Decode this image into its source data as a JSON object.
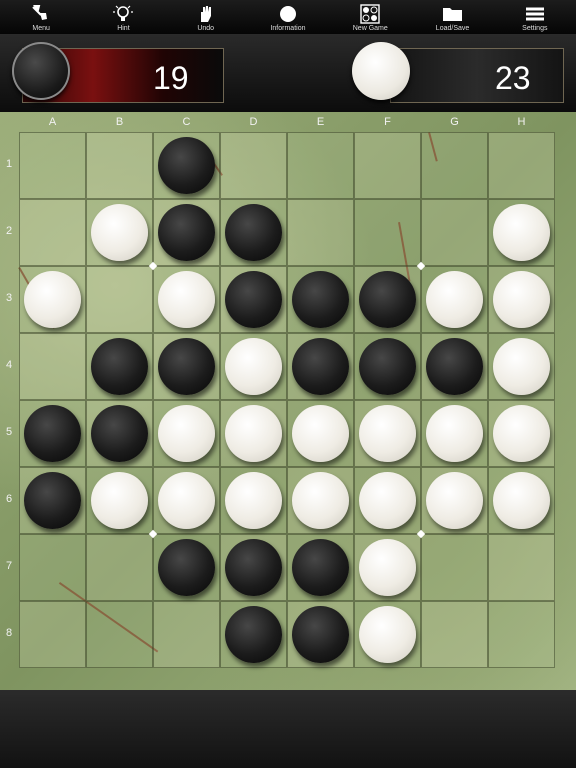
{
  "toolbar": {
    "items": [
      {
        "label": "Menu",
        "icon": "menu-hand-icon"
      },
      {
        "label": "Hint",
        "icon": "lightbulb-icon"
      },
      {
        "label": "Undo",
        "icon": "hand-icon"
      },
      {
        "label": "Information",
        "icon": "info-dot-icon"
      },
      {
        "label": "New Game",
        "icon": "new-game-grid-icon"
      },
      {
        "label": "Load/Save",
        "icon": "folder-icon"
      },
      {
        "label": "Settings",
        "icon": "wrench-icon"
      }
    ]
  },
  "scores": {
    "black": "19",
    "white": "23"
  },
  "board": {
    "columns": [
      "A",
      "B",
      "C",
      "D",
      "E",
      "F",
      "G",
      "H"
    ],
    "rows": [
      "1",
      "2",
      "3",
      "4",
      "5",
      "6",
      "7",
      "8"
    ],
    "cells": [
      [
        "",
        "",
        "B",
        "",
        "",
        "",
        "",
        ""
      ],
      [
        "",
        "W",
        "B",
        "B",
        "",
        "",
        "",
        "W"
      ],
      [
        "W",
        "",
        "W",
        "B",
        "B",
        "B",
        "W",
        "W"
      ],
      [
        "",
        "B",
        "B",
        "W",
        "B",
        "B",
        "B",
        "W"
      ],
      [
        "B",
        "B",
        "W",
        "W",
        "W",
        "W",
        "W",
        "W"
      ],
      [
        "B",
        "W",
        "W",
        "W",
        "W",
        "W",
        "W",
        "W"
      ],
      [
        "",
        "",
        "B",
        "B",
        "B",
        "W",
        "",
        ""
      ],
      [
        "",
        "",
        "",
        "B",
        "B",
        "W",
        "",
        ""
      ]
    ]
  },
  "colors": {
    "black_disc": "#1c1c1c",
    "white_disc": "#efece4",
    "board": "#9aac78",
    "black_panel": "#7a1010"
  }
}
